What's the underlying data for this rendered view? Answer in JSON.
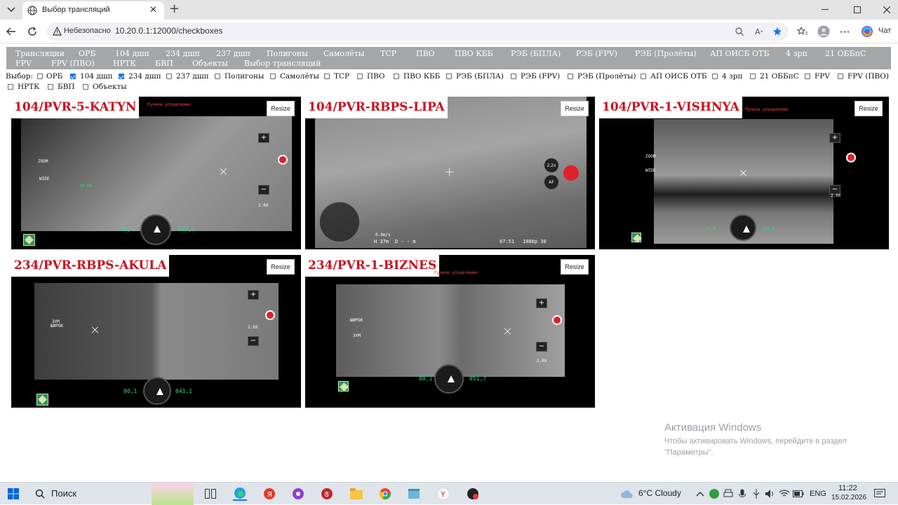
{
  "browser": {
    "tab_title": "Выбор трансляций",
    "new_tab": "+",
    "security_label": "Небезопасно",
    "url": "10.20.0.1:12000/checkboxes",
    "copilot_label": "Чат",
    "accent": "#1a73e8"
  },
  "nav": {
    "links": [
      "Трансляции",
      "ОРБ",
      "104 дшп",
      "234 дшп",
      "237 дшп",
      "Полигоны",
      "Самолёты",
      "ТСР",
      "ПВО",
      "ПВО КББ",
      "РЭБ (БПЛА)",
      "РЭБ (FPV)",
      "РЭБ (Пролёты)",
      "АП ОИСБ ОТБ",
      "4 зрп",
      "21 ОББпС",
      "FPV",
      "FPV (ПВО)",
      "НРТК",
      "БВП",
      "Объекты",
      "Выбор трансляций"
    ]
  },
  "filter": {
    "label": "Выбор:",
    "options": [
      {
        "label": "ОРБ",
        "checked": false
      },
      {
        "label": "104 дшп",
        "checked": true
      },
      {
        "label": "234 дшп",
        "checked": true
      },
      {
        "label": "237 дшп",
        "checked": false
      },
      {
        "label": "Полигоны",
        "checked": false
      },
      {
        "label": "Самолёты",
        "checked": false
      },
      {
        "label": "ТСР",
        "checked": false
      },
      {
        "label": "ПВО",
        "checked": false
      },
      {
        "label": "ПВО КББ",
        "checked": false
      },
      {
        "label": "РЭБ (БПЛА)",
        "checked": false
      },
      {
        "label": "РЭБ (FPV)",
        "checked": false
      },
      {
        "label": "РЭБ (Пролёты)",
        "checked": false
      },
      {
        "label": "АП ОИСБ ОТБ",
        "checked": false
      },
      {
        "label": "4 зрп",
        "checked": false
      },
      {
        "label": "21 ОББпС",
        "checked": false
      },
      {
        "label": "FPV",
        "checked": false
      },
      {
        "label": "FPV (ПВО)",
        "checked": false
      },
      {
        "label": "НРТК",
        "checked": false
      },
      {
        "label": "БВП",
        "checked": false
      },
      {
        "label": "Объекты",
        "checked": false
      }
    ]
  },
  "feeds": [
    {
      "title": "104/PVR-5-KATYN",
      "resize": "Resize",
      "hud": {
        "mode": "Ручное управление",
        "zoom": "14.0X",
        "zoom2": "2.0X",
        "speed": "00,0",
        "alt": "041,2",
        "label1": "ZOOM",
        "label2": "WIDE"
      }
    },
    {
      "title": "104/PVR-RBPS-LIPA",
      "resize": "Resize",
      "hud": {
        "zoom": "2,2x",
        "af": "AF",
        "hd": "H 37m",
        "d": "D - - m",
        "res": "1080p 30",
        "time": "07:51",
        "speed": "0.0m/s"
      }
    },
    {
      "title": "104/PVR-1-VISHNYA",
      "resize": "Resize",
      "hud": {
        "mode": "Ручное управление",
        "zoom": "2.0X",
        "speed": "00,0",
        "alt": "040,9",
        "label1": "ZOOM",
        "label2": "WIDE"
      }
    },
    {
      "title": "234/PVR-RBPS-AKULA",
      "resize": "Resize",
      "hud": {
        "zoom": "2.0X",
        "speed": "00,1",
        "alt": "041,1",
        "label1": "ЗУМ",
        "label2": "ШИРОК"
      }
    },
    {
      "title": "234/PVR-1-BIZNES",
      "resize": "Resize",
      "hud": {
        "mode": "Ручное управление",
        "zoom": "2.0X",
        "speed": "00,1",
        "alt": "051,7",
        "label1": "ШИРОК",
        "label2": "ЗУМ"
      }
    }
  ],
  "activation": {
    "heading": "Активация Windows",
    "line1": "Чтобы активировать Windows, перейдите в раздел",
    "line2": "\"Параметры\"."
  },
  "taskbar": {
    "search_placeholder": "Поиск",
    "weather": "6°C  Cloudy",
    "lang": "ENG",
    "time": "11:22",
    "date": "15.02.2026"
  }
}
